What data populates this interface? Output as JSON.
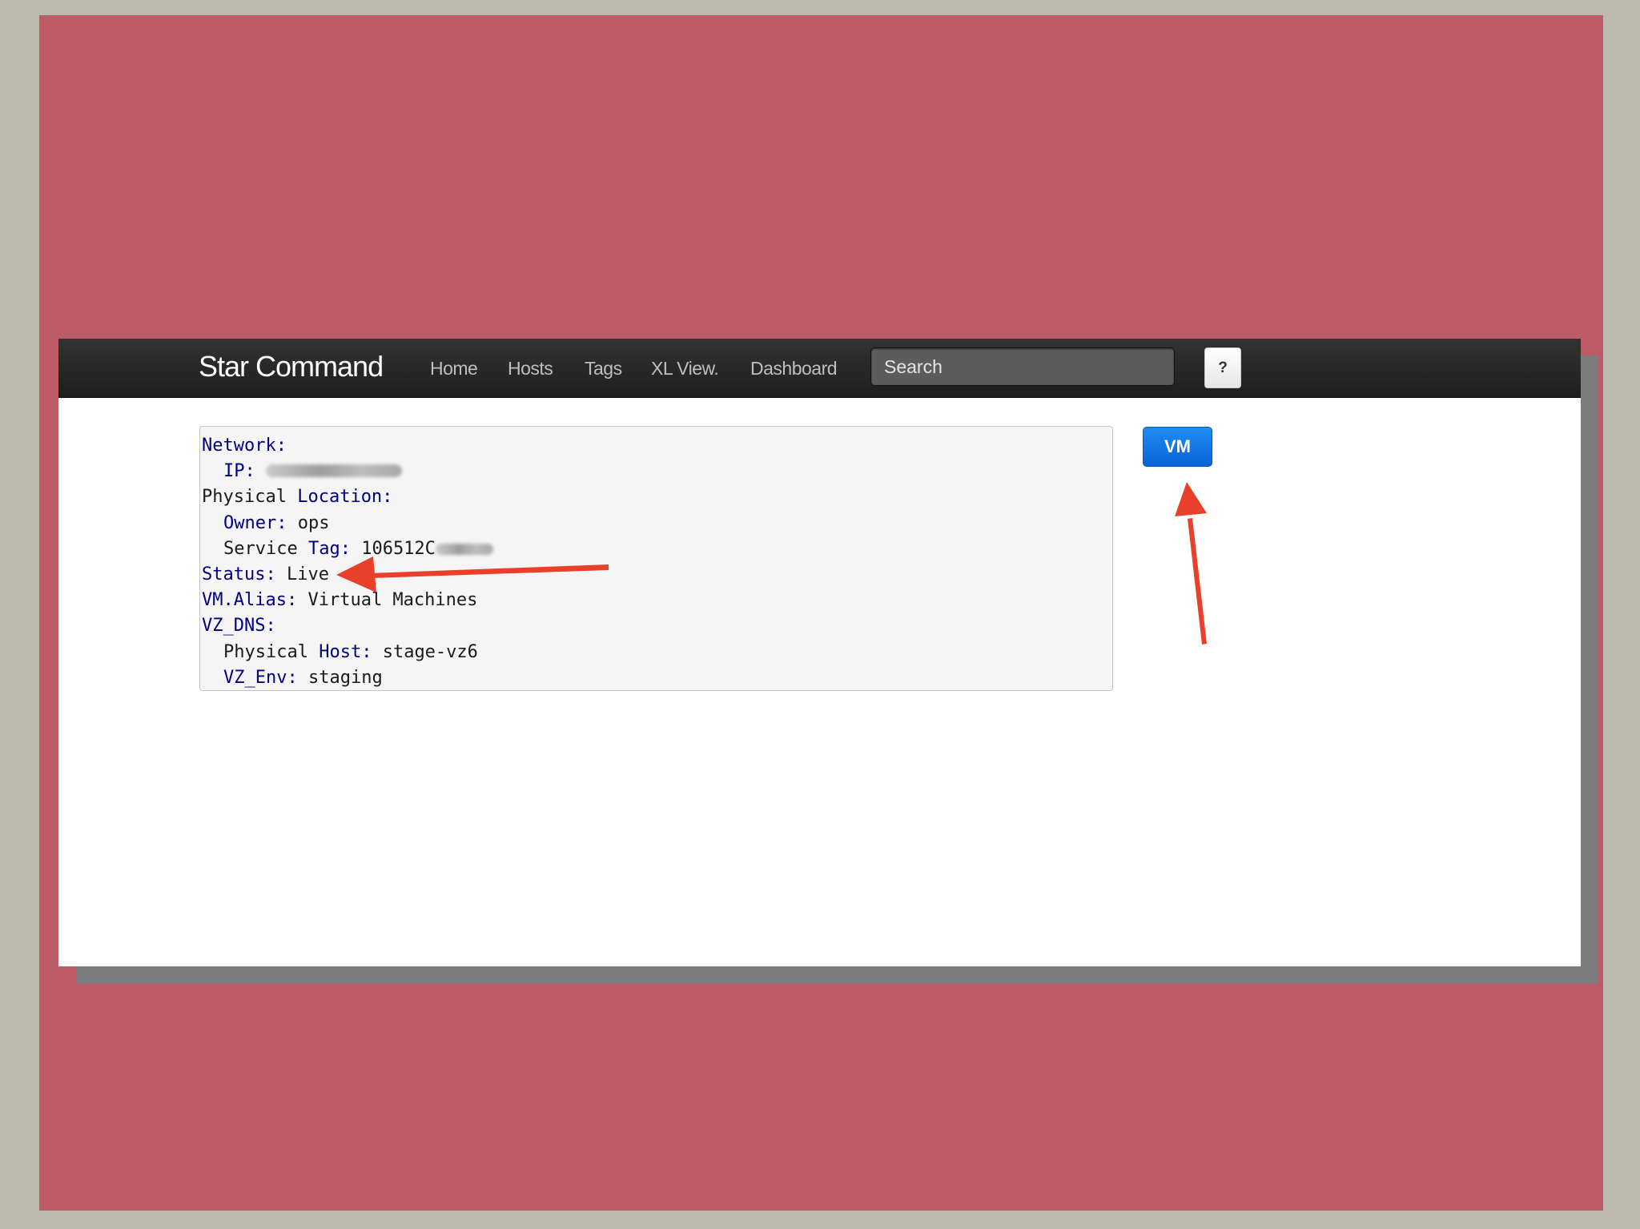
{
  "navbar": {
    "brand": "Star Command",
    "nav_items": [
      "Home",
      "Hosts",
      "Tags",
      "XL View.",
      "Dashboard"
    ],
    "search_placeholder": "Search",
    "help_label": "?"
  },
  "host_info": {
    "network_key": "Network:",
    "ip_key": "IP:",
    "physical_location_key_a": "Physical",
    "physical_location_key_b": "Location:",
    "owner_key": "Owner:",
    "owner_value": "ops",
    "service_tag_key_a": "Service",
    "service_tag_key_b": "Tag:",
    "service_tag_value": "106512C",
    "status_key": "Status:",
    "status_value": "Live",
    "vm_alias_key": "VM.Alias:",
    "vm_alias_value": "Virtual Machines",
    "vz_dns_key": "VZ_DNS:",
    "physical_host_key_a": "Physical",
    "physical_host_key_b": "Host:",
    "physical_host_value": "stage-vz6",
    "vz_env_key": "VZ_Env:",
    "vz_env_value": "staging"
  },
  "vm_button_label": "VM",
  "colors": {
    "backdrop": "#bd5b66",
    "navbar": "#262626",
    "key_text": "#000080",
    "vm_button": "#1478e6",
    "annotation_arrow": "#e8402a"
  }
}
